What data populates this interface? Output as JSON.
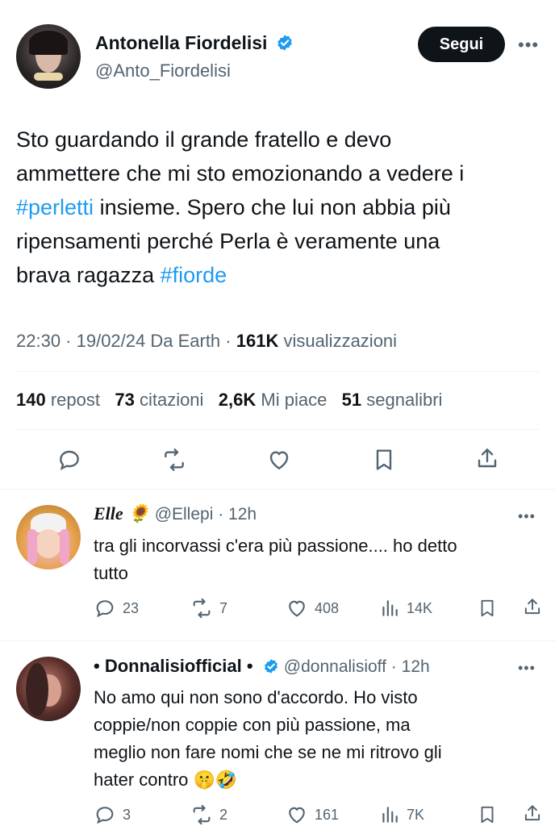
{
  "tweet": {
    "author_name": "Antonella Fiordelisi",
    "author_handle": "@Anto_Fiordelisi",
    "follow_label": "Segui",
    "more_label": "•••",
    "text_line1": "Sto guardando il grande fratello e devo",
    "text_line2": "ammettere che mi sto emozionando a vedere i",
    "hashtag1": "#perletti",
    "text_line3_rest": " insieme. Spero che lui non abbia più",
    "text_line4": "ripensamenti perché Perla è veramente una",
    "text_line5": "brava ragazza ",
    "hashtag2": "#fiorde",
    "time": "22:30 · 19/02/24 Da Earth · ",
    "views_count": "161K",
    "views_label": " visualizzazioni",
    "stats": {
      "reposts_num": "140",
      "reposts_label": "repost",
      "quotes_num": "73",
      "quotes_label": "citazioni",
      "likes_num": "2,6K",
      "likes_label": "Mi piace",
      "bookmarks_num": "51",
      "bookmarks_label": "segnalibri"
    }
  },
  "replies": [
    {
      "name": "Elle 🌻",
      "handle": "@Ellepi · 12h",
      "line1": "tra gli incorvassi c'era più passione.... ho detto",
      "line2": "tutto",
      "replies": "23",
      "reposts": "7",
      "likes": "408",
      "views": "14K"
    },
    {
      "name": "• Donnalisiofficial •",
      "handle": "@donnalisioff · 12h",
      "line1": "No amo qui non sono d'accordo. Ho visto",
      "line2": "coppie/non coppie con più passione, ma",
      "line3": "meglio non fare nomi che se ne mi ritrovo gli",
      "line4": "hater contro 🤫🤣",
      "replies": "3",
      "reposts": "2",
      "likes": "161",
      "views": "7K"
    }
  ],
  "colors": {
    "accent": "#1d9bf0",
    "text": "#0f1419",
    "secondary": "#536471",
    "divider": "#eff3f4"
  }
}
